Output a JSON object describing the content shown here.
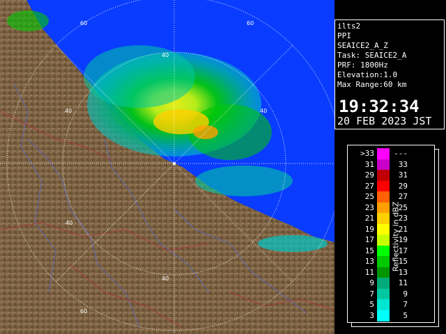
{
  "info_panel": {
    "radar_name": "ilts2",
    "scan_mode": "PPI",
    "product": "SEAICE2_A_Z",
    "task": "Task: SEAICE2_A",
    "prf": "PRF: 1800Hz",
    "elevation": "Elevation:1.0",
    "max_range": "Max Range:60 km",
    "time": "19:32:34",
    "date": "20 FEB 2023 JST"
  },
  "legend": {
    "title": "Reflectivity in dBZ",
    "rows": [
      {
        "left": ">33",
        "right": "---",
        "color": "#ff00ff"
      },
      {
        "left": "31",
        "right": "33",
        "color": "#c800c8"
      },
      {
        "left": "29",
        "right": "31",
        "color": "#c00000"
      },
      {
        "left": "27",
        "right": "29",
        "color": "#ff0000"
      },
      {
        "left": "25",
        "right": "27",
        "color": "#ff6000"
      },
      {
        "left": "23",
        "right": "25",
        "color": "#ffa000"
      },
      {
        "left": "21",
        "right": "23",
        "color": "#ffd000"
      },
      {
        "left": "19",
        "right": "21",
        "color": "#ffff00"
      },
      {
        "left": "17",
        "right": "19",
        "color": "#c8ff00"
      },
      {
        "left": "15",
        "right": "17",
        "color": "#00ff00"
      },
      {
        "left": "13",
        "right": "15",
        "color": "#00c800"
      },
      {
        "left": "11",
        "right": "13",
        "color": "#009600"
      },
      {
        "left": "9",
        "right": "11",
        "color": "#00aa78"
      },
      {
        "left": "7",
        "right": "9",
        "color": "#00c8a0"
      },
      {
        "left": "5",
        "right": "7",
        "color": "#00e6d2"
      },
      {
        "left": "3",
        "right": "5",
        "color": "#00ffff"
      }
    ]
  },
  "range_rings": {
    "labels": [
      "60",
      "40",
      "40",
      "60",
      "40",
      "40",
      "40",
      "60"
    ]
  },
  "colors": {
    "sea": "#0a3cff",
    "land": "#7a6040",
    "ring": "#ffffff"
  }
}
